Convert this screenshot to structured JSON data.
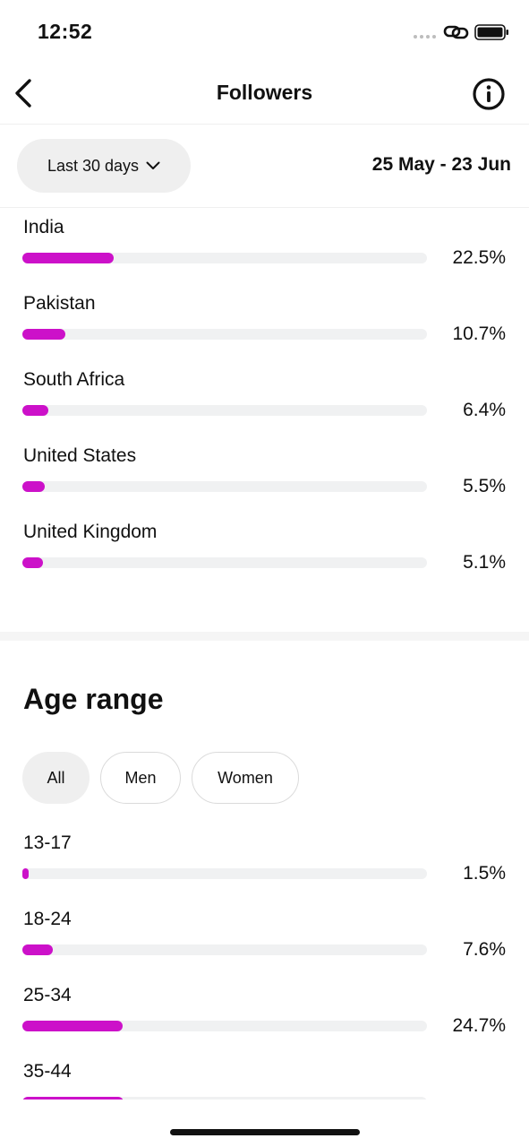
{
  "status_bar": {
    "time": "12:52"
  },
  "nav": {
    "title": "Followers"
  },
  "filter": {
    "range_label": "Last 30 days",
    "date_range": "25 May - 23 Jun"
  },
  "countries": [
    {
      "label": "India",
      "value": "22.5%",
      "pct": 22.5
    },
    {
      "label": "Pakistan",
      "value": "10.7%",
      "pct": 10.7
    },
    {
      "label": "South Africa",
      "value": "6.4%",
      "pct": 6.4
    },
    {
      "label": "United States",
      "value": "5.5%",
      "pct": 5.5
    },
    {
      "label": "United Kingdom",
      "value": "5.1%",
      "pct": 5.1
    }
  ],
  "age_range": {
    "title": "Age range",
    "chips": [
      "All",
      "Men",
      "Women"
    ],
    "selected_chip": "All",
    "items": [
      {
        "label": "13-17",
        "value": "1.5%",
        "pct": 1.5
      },
      {
        "label": "18-24",
        "value": "7.6%",
        "pct": 7.6
      },
      {
        "label": "25-34",
        "value": "24.7%",
        "pct": 24.7
      },
      {
        "label": "35-44",
        "value": "",
        "pct": 25.0
      }
    ]
  },
  "colors": {
    "accent": "#cc11c9",
    "track": "#f0f1f2",
    "chip_bg": "#efefef"
  }
}
